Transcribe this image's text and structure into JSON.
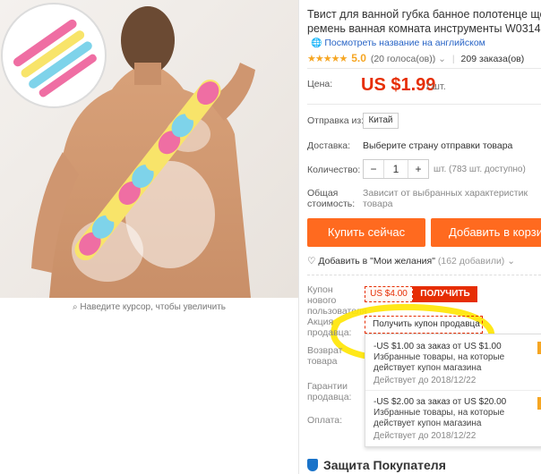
{
  "product": {
    "title_line1": "Твист для ванной губка банное полотенце щетка т",
    "title_line2": "ремень ванная комната инструменты W0314",
    "translate_link": "Посмотреть название на английском",
    "stars": "★★★★★",
    "score": "5.0",
    "votes": "(20 голоса(ов))",
    "orders": "209 заказа(ов)"
  },
  "price": {
    "label": "Цена:",
    "value": "US $1.99",
    "unit": "/ шт."
  },
  "ship_from": {
    "label": "Отправка из:",
    "value": "Китай"
  },
  "delivery": {
    "label": "Доставка:",
    "value": "Выберите страну отправки товара"
  },
  "quantity": {
    "label": "Количество:",
    "minus": "−",
    "value": "1",
    "plus": "+",
    "note": "шт. (783 шт. доступно)"
  },
  "total": {
    "label": "Общая стоимость:",
    "value": "Зависит от выбранных характеристик товара"
  },
  "actions": {
    "buy": "Купить сейчас",
    "cart": "Добавить в корзи"
  },
  "wishlist": {
    "label": "Добавить в \"Мои желания\"",
    "count": "(162 добавили)"
  },
  "new_user_coupon": {
    "label": "Купон нового пользователя",
    "amount": "US $4.00",
    "button": "ПОЛУЧИТЬ"
  },
  "seller_promo": {
    "label": "Акция продавца:",
    "select": "Получить купон продавца"
  },
  "returns": {
    "label": "Возврат товара"
  },
  "guarantee": {
    "label": "Гарантии продавца:"
  },
  "payment": {
    "label": "Оплата:"
  },
  "offers": [
    {
      "line1": "-US $1.00 за заказ от US $1.00",
      "line2": "Избранные товары, на которые",
      "line3": "действует купон магазина",
      "expiry": "Действует до 2018/12/22"
    },
    {
      "line1": "-US $2.00 за заказ от US $20.00",
      "line2": "Избранные товары, на которые",
      "line3": "действует купон магазина",
      "expiry": "Действует до 2018/12/22"
    }
  ],
  "zoom_hint": "Наведите курсор, чтобы увеличить",
  "buyer_protection": "Защита Покупателя",
  "colors": {
    "accent": "#ff6a1f",
    "price": "#e62e04",
    "link": "#2864c6",
    "highlight": "#ffe600"
  }
}
